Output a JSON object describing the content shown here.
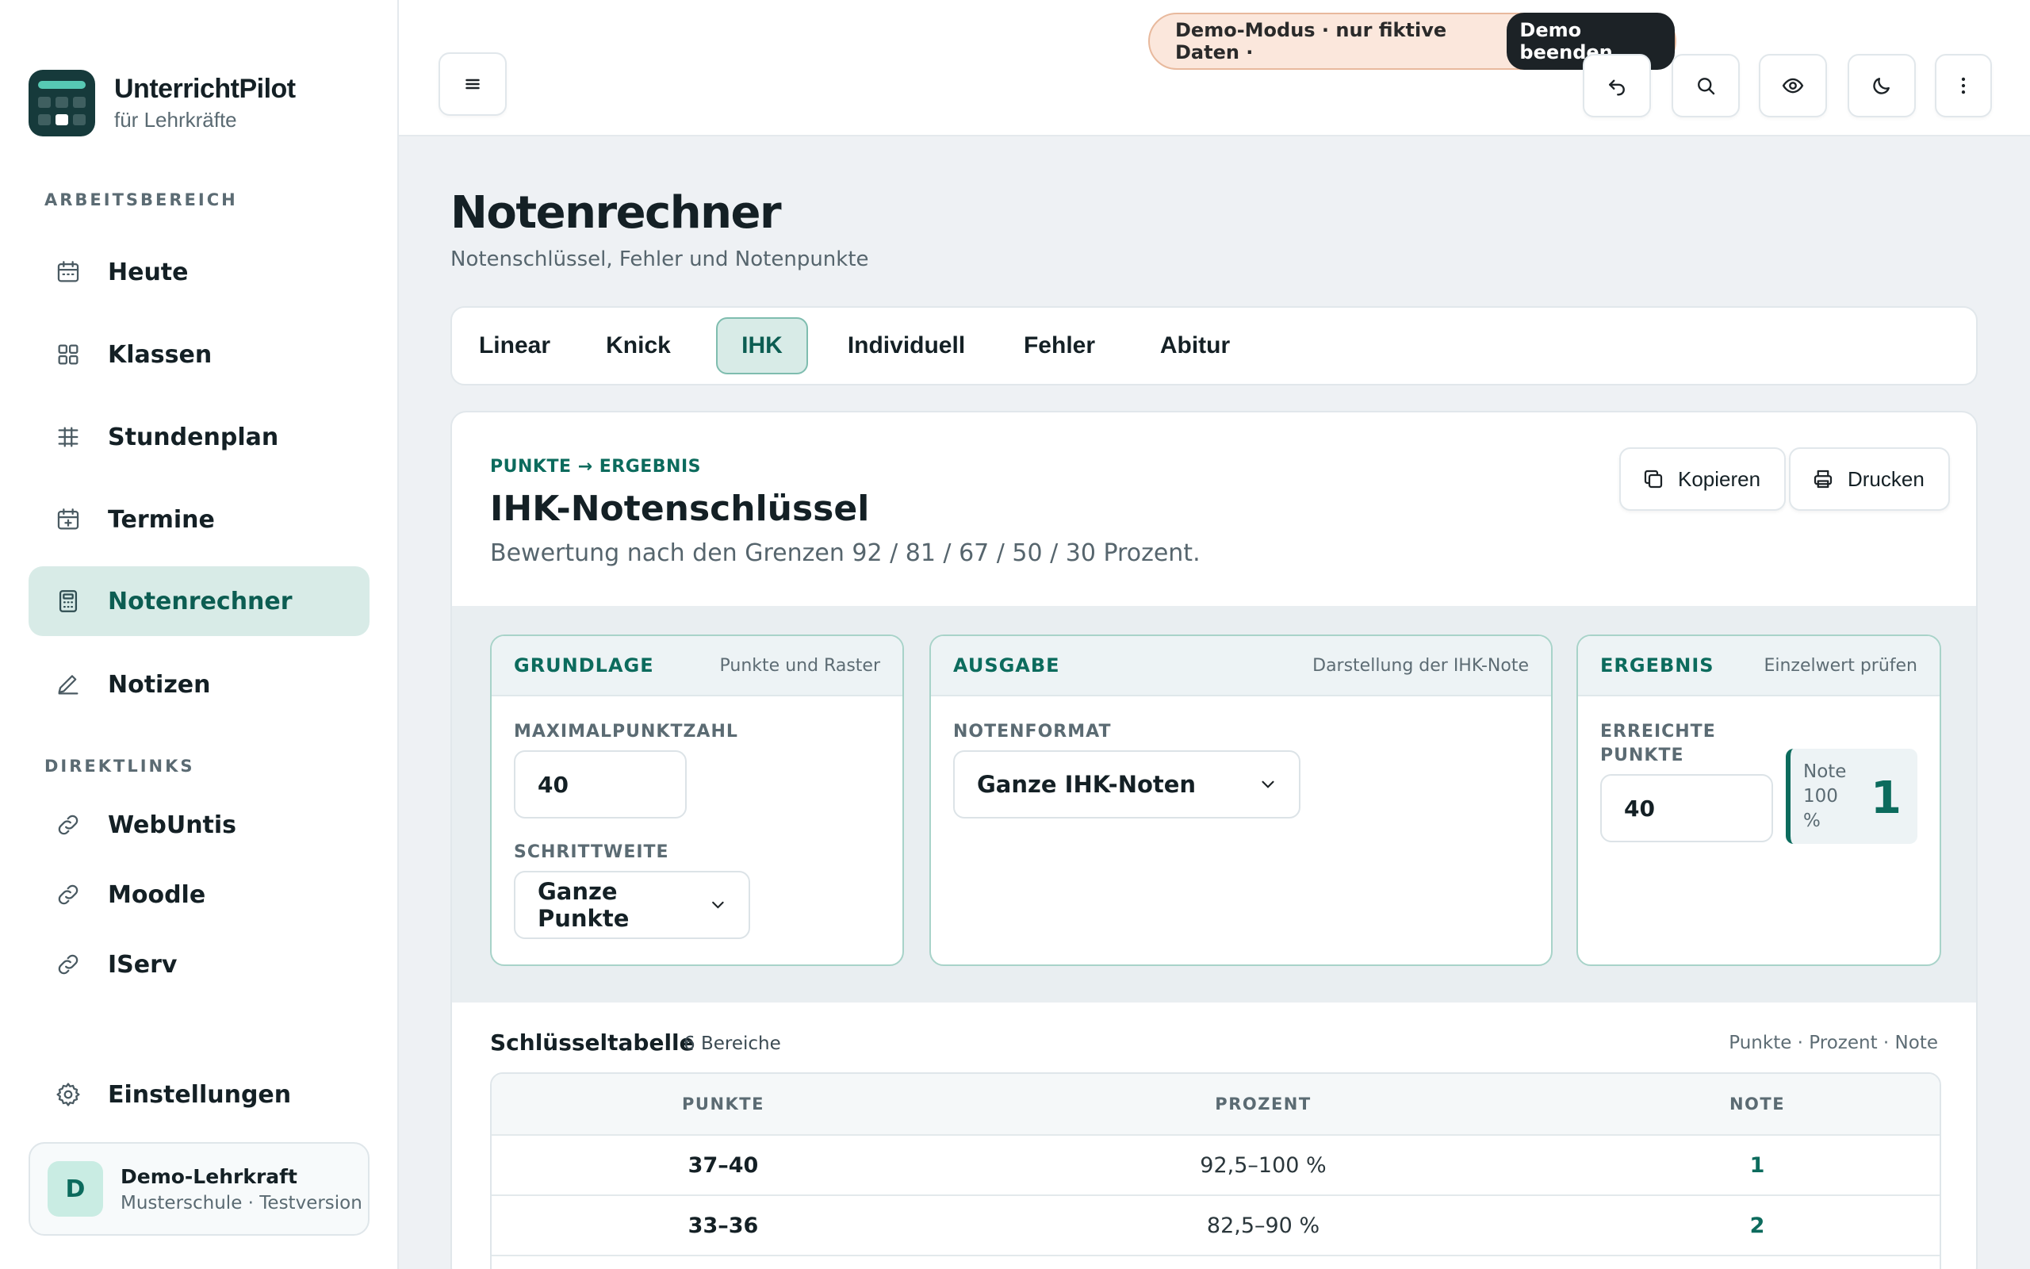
{
  "app": {
    "name": "UnterrichtPilot",
    "subtitle": "für Lehrkräfte"
  },
  "sidebar": {
    "workspace_label": "ARBEITSBEREICH",
    "items": [
      {
        "label": "Heute",
        "icon": "calendar-icon"
      },
      {
        "label": "Klassen",
        "icon": "grid-icon"
      },
      {
        "label": "Stundenplan",
        "icon": "timetable-icon"
      },
      {
        "label": "Termine",
        "icon": "calendar-plus-icon"
      },
      {
        "label": "Notenrechner",
        "icon": "calculator-icon",
        "active": true
      },
      {
        "label": "Notizen",
        "icon": "pencil-icon"
      }
    ],
    "links_label": "DIREKTLINKS",
    "links": [
      {
        "label": "WebUntis",
        "icon": "link-icon"
      },
      {
        "label": "Moodle",
        "icon": "link-icon"
      },
      {
        "label": "IServ",
        "icon": "link-icon"
      }
    ],
    "settings_label": "Einstellungen",
    "user": {
      "initial": "D",
      "name": "Demo-Lehrkraft",
      "school": "Musterschule · Testversion"
    }
  },
  "topbar": {
    "demo_text": "Demo-Modus · nur fiktive Daten ·",
    "demo_end": "Demo beenden",
    "icons": [
      "menu-icon",
      "undo-icon",
      "search-icon",
      "eye-icon",
      "moon-icon",
      "more-vertical-icon"
    ]
  },
  "page": {
    "title": "Notenrechner",
    "subtitle": "Notenschlüssel, Fehler und Notenpunkte",
    "tabs": [
      "Linear",
      "Knick",
      "IHK",
      "Individuell",
      "Fehler",
      "Abitur"
    ],
    "active_tab": "IHK"
  },
  "card": {
    "kicker": "PUNKTE → ERGEBNIS",
    "title": "IHK-Notenschlüssel",
    "description": "Bewertung nach den Grenzen 92 / 81 / 67 / 50 / 30 Prozent.",
    "copy_label": "Kopieren",
    "print_label": "Drucken"
  },
  "panels": {
    "grundlage": {
      "name": "GRUNDLAGE",
      "hint": "Punkte und Raster",
      "max_label": "MAXIMALPUNKTZAHL",
      "max_value": "40",
      "step_label": "SCHRITTWEITE",
      "step_value": "Ganze Punkte"
    },
    "ausgabe": {
      "name": "AUSGABE",
      "hint": "Darstellung der IHK-Note",
      "format_label": "NOTENFORMAT",
      "format_value": "Ganze IHK-Noten"
    },
    "ergebnis": {
      "name": "ERGEBNIS",
      "hint": "Einzelwert prüfen",
      "points_label_1": "ERREICHTE",
      "points_label_2": "PUNKTE",
      "points_value": "40",
      "result_note": "Note",
      "result_pct": "100",
      "result_pct_unit": "%",
      "result_grade": "1"
    }
  },
  "table": {
    "title": "Schlüsseltabelle",
    "count": "6 Bereiche",
    "legend": "Punkte · Prozent · Note",
    "headers": [
      "PUNKTE",
      "PROZENT",
      "NOTE"
    ],
    "rows": [
      {
        "points": "37–40",
        "percent": "92,5–100 %",
        "grade": "1"
      },
      {
        "points": "33–36",
        "percent": "82,5–90 %",
        "grade": "2"
      }
    ]
  },
  "colors": {
    "accent": "#0c6b5d",
    "active_bg": "#d8ebe7",
    "demo_bg": "#fbe7dc"
  }
}
